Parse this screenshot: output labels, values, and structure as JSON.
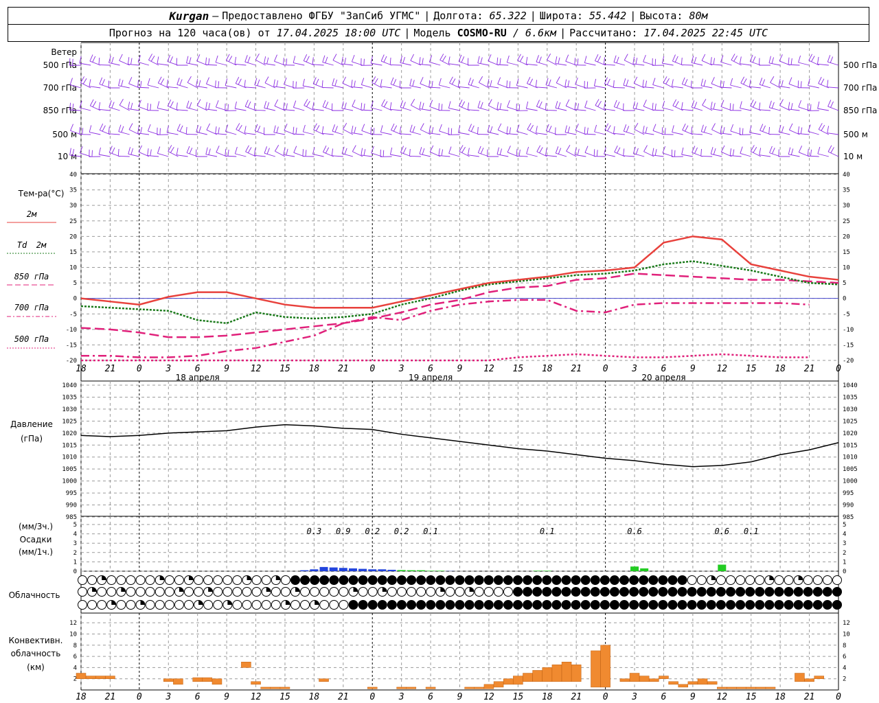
{
  "header": {
    "station": "Kurgan",
    "dash": "—",
    "provider": "Предоставлено ФГБУ \"ЗапСиб УГМС\"",
    "lon_label": "Долгота:",
    "lon": "65.322",
    "lat_label": "Широта:",
    "lat": "55.442",
    "alt_label": "Высота:",
    "alt": "80м",
    "forecast_label": "Прогноз на 120 часа(ов) от",
    "forecast_from": "17.04.2025 18:00 UTC",
    "model_label": "Модель",
    "model": "COSMO-RU",
    "model_res": "/ 6.6км",
    "calc_label": "Рассчитано:",
    "calc": "17.04.2025 22:45 UTC"
  },
  "labels": {
    "wind": "Ветер",
    "levels": [
      "500 гПа",
      "700 гПа",
      "850 гПа",
      "500 м",
      "10  м"
    ],
    "temp": "Тем-ра(°C)",
    "t2m": "2м",
    "td": "Td",
    "td_suffix": "2м",
    "t850": "850 гПа",
    "t700": "700 гПа",
    "t500": "500 гПа",
    "pressure": "Давление",
    "pressure_unit": "(гПа)",
    "precip_unit3": "(мм/3ч.)",
    "precip": "Осадки",
    "precip_unit1": "(мм/1ч.)",
    "cloud": "Облачность",
    "conv1": "Конвективн.",
    "conv2": "облачность",
    "conv3": "(км)"
  },
  "colors": {
    "t2m": "#e8413c",
    "td": "#1a7a1a",
    "t850": "#e0207a",
    "t700": "#e0207a",
    "t500": "#e0207a",
    "wind": "#8a2be2",
    "precip_blue": "#2244dd",
    "precip_green": "#22cc22",
    "conv": "#f08a30"
  },
  "chart_data": {
    "type": "line",
    "x_hours_labels": [
      "18",
      "21",
      "0",
      "3",
      "6",
      "9",
      "12",
      "15",
      "18",
      "21",
      "0",
      "3",
      "6",
      "9",
      "12",
      "15",
      "18",
      "21",
      "0",
      "3",
      "6",
      "9",
      "12",
      "15",
      "18",
      "21",
      "0"
    ],
    "day_labels": [
      "18 апреля",
      "19 апреля",
      "20 апреля"
    ],
    "temperature": {
      "ylim": [
        -20,
        40
      ],
      "yticks": [
        -20,
        -15,
        -10,
        -5,
        0,
        5,
        10,
        15,
        20,
        25,
        30,
        35,
        40
      ],
      "x": [
        0,
        3,
        6,
        9,
        12,
        15,
        18,
        21,
        24,
        27,
        30,
        33,
        36,
        39,
        42,
        45,
        48,
        51,
        54,
        57,
        60,
        63,
        66,
        69,
        72,
        75,
        78
      ],
      "t2m": [
        0,
        -1,
        -2,
        0.5,
        2,
        2,
        0,
        -2,
        -3,
        -3,
        -3,
        -1,
        1,
        3,
        5,
        6,
        7,
        8.5,
        9,
        10,
        18,
        20,
        19,
        11,
        9,
        7,
        6
      ],
      "td2m": [
        -2.5,
        -3,
        -3.5,
        -4,
        -7,
        -8,
        -4.5,
        -6,
        -6.5,
        -6,
        -5,
        -2,
        0,
        2.5,
        4.5,
        5.5,
        6.5,
        7.5,
        8,
        9,
        11,
        12,
        10.5,
        9,
        7,
        5,
        4.5
      ],
      "t850": [
        -9.5,
        -10,
        -11,
        -12.5,
        -12.5,
        -12,
        -11,
        -10,
        -9,
        -8,
        -6.5,
        -4.5,
        -2,
        -0.5,
        2,
        3.5,
        4,
        6,
        6.5,
        8,
        7.5,
        7,
        6.5,
        6,
        6,
        5.5,
        5
      ],
      "t700": [
        -18.5,
        -18.5,
        -19,
        -19,
        -18.5,
        -17,
        -16,
        -14,
        -12,
        -8,
        -6,
        -7,
        -4,
        -2,
        -1,
        -0.5,
        -0.5,
        -4,
        -4.5,
        -2,
        -1.5,
        -1.5,
        -1.5,
        -1.5,
        -1.5,
        -2
      ],
      "t500": [
        -20,
        -20,
        -20,
        -20,
        -20,
        -20,
        -20,
        -20,
        -20,
        -20,
        -20,
        -20,
        -20,
        -20,
        -20,
        -19,
        -18.5,
        -18,
        -18.5,
        -19,
        -19,
        -18.5,
        -18,
        -18.5,
        -19,
        -19
      ]
    },
    "pressure": {
      "ylim": [
        985,
        1040
      ],
      "yticks": [
        985,
        990,
        995,
        1000,
        1005,
        1010,
        1015,
        1020,
        1025,
        1030,
        1035,
        1040
      ],
      "x": [
        0,
        3,
        6,
        9,
        12,
        15,
        18,
        21,
        24,
        27,
        30,
        33,
        36,
        39,
        42,
        45,
        48,
        51,
        54,
        57,
        60,
        63,
        66,
        69,
        72,
        75,
        78
      ],
      "values": [
        1019,
        1018.5,
        1019,
        1020,
        1020.5,
        1021,
        1022.5,
        1023.5,
        1023,
        1022,
        1021.5,
        1019.5,
        1018,
        1016.5,
        1015,
        1013.5,
        1012.5,
        1011,
        1009.5,
        1008.5,
        1007,
        1006,
        1006.5,
        1008,
        1011,
        1013,
        1016
      ]
    },
    "precip": {
      "ylim": [
        0,
        5
      ],
      "labels": [
        {
          "x": 24,
          "text": "0.3"
        },
        {
          "x": 27,
          "text": "0.9"
        },
        {
          "x": 30,
          "text": "0.2"
        },
        {
          "x": 33,
          "text": "0.2"
        },
        {
          "x": 36,
          "text": "0.1"
        },
        {
          "x": 48,
          "text": "0.1"
        },
        {
          "x": 57,
          "text": "0.6"
        },
        {
          "x": 66,
          "text": "0.6"
        },
        {
          "x": 69,
          "text": "0.1"
        }
      ],
      "hourly": [
        0,
        0.1,
        0.2,
        0.45,
        0.4,
        0.35,
        0.3,
        0.25,
        0.2,
        0.2,
        0.15,
        0.12,
        0.1,
        0.1,
        0.05,
        0.05,
        0.02,
        0,
        0.05,
        0.05,
        0,
        0.5,
        0.3,
        0.7
      ],
      "hourly_x": [
        22,
        23,
        24,
        25,
        26,
        27,
        28,
        29,
        30,
        31,
        32,
        33,
        34,
        35,
        36,
        37,
        38,
        39,
        47,
        48,
        56,
        57,
        58,
        66
      ]
    },
    "convective": {
      "ylim": [
        0,
        13
      ],
      "yticks": [
        2,
        4,
        6,
        8,
        10,
        12
      ],
      "x": [
        0,
        1,
        2,
        3,
        9,
        10,
        12,
        13,
        14,
        17,
        18,
        19,
        20,
        21,
        25,
        30,
        33,
        34,
        36,
        40,
        41,
        42,
        43,
        44,
        45,
        46,
        47,
        48,
        49,
        50,
        51,
        53,
        54,
        56,
        57,
        58,
        59,
        60,
        61,
        62,
        63,
        64,
        65,
        66,
        67,
        68,
        69,
        70,
        71,
        74,
        75,
        76
      ],
      "top": [
        3,
        2.5,
        2.5,
        2.5,
        2,
        2,
        2.2,
        2.2,
        2,
        5,
        1.5,
        0.5,
        0.5,
        0.5,
        2,
        0.5,
        0.5,
        0.5,
        0.5,
        0.5,
        0.5,
        1,
        1.5,
        2,
        2.5,
        3,
        3.5,
        4,
        4.5,
        5,
        4.5,
        7,
        8,
        2,
        3,
        2.5,
        2,
        2.5,
        1.5,
        1,
        1.5,
        2,
        1.5,
        0.5,
        0.5,
        0.5,
        0.5,
        0.5,
        0.5,
        3,
        2,
        2.5
      ],
      "bottom": [
        2,
        2,
        2,
        2,
        1.5,
        1,
        1.5,
        1.5,
        1,
        4,
        1,
        0.2,
        0.2,
        0.2,
        1.5,
        0.2,
        0.2,
        0.2,
        0.2,
        0.2,
        0.2,
        0.2,
        0.5,
        1,
        1,
        1.5,
        1.5,
        1.5,
        1.5,
        1.5,
        1.5,
        0.5,
        0.5,
        1.5,
        1.5,
        1.5,
        1.5,
        2,
        1,
        0.5,
        1,
        1,
        1,
        0.2,
        0.2,
        0.2,
        0.2,
        0.2,
        0.2,
        1.5,
        1.5,
        2
      ]
    }
  }
}
